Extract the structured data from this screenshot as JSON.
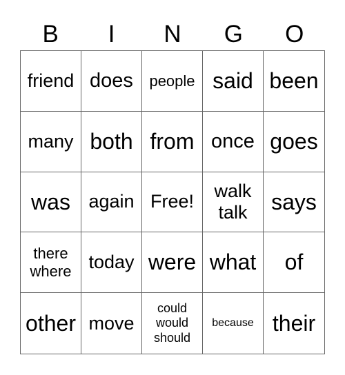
{
  "header": {
    "letters": [
      "B",
      "I",
      "N",
      "G",
      "O"
    ]
  },
  "grid": {
    "rows": [
      [
        "friend",
        "does",
        "people",
        "said",
        "been"
      ],
      [
        "many",
        "both",
        "from",
        "once",
        "goes"
      ],
      [
        "was",
        "again",
        "Free!",
        "walk\ntalk",
        "says"
      ],
      [
        "there\nwhere",
        "today",
        "were",
        "what",
        "of"
      ],
      [
        "other",
        "move",
        "could\nwould\nshould",
        "because",
        "their"
      ]
    ]
  }
}
